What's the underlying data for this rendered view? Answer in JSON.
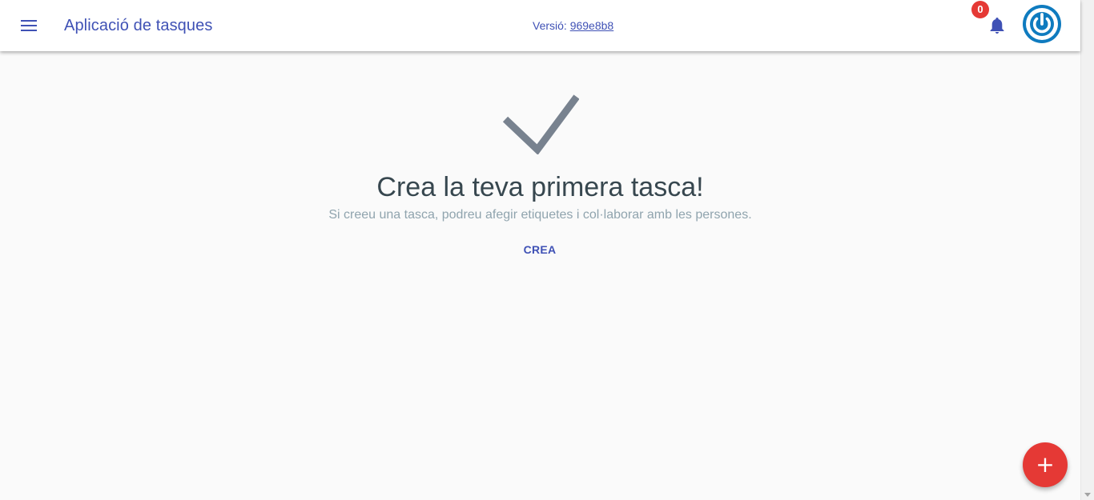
{
  "toolbar": {
    "menu_icon": "hamburger-menu-icon",
    "title": "Aplicació de tasques",
    "version_label": "Versió:",
    "version_value": "969e8b8",
    "notifications_icon": "bell-icon",
    "notifications_count": "0",
    "avatar_icon": "power-icon"
  },
  "empty_state": {
    "icon": "check-icon",
    "title": "Crea la teva primera tasca!",
    "subtitle": "Si creeu una tasca, podreu afegir etiquetes i col·laborar amb les persones.",
    "create_label": "CREA"
  },
  "fab": {
    "label": "+",
    "icon": "add-icon"
  },
  "colors": {
    "primary": "#3f51b5",
    "accent": "#e53935",
    "avatar": "#0f7bbf",
    "check": "#78828f",
    "title_text": "#37474f",
    "subtitle_text": "#90a4ae",
    "background": "#fafafa"
  }
}
